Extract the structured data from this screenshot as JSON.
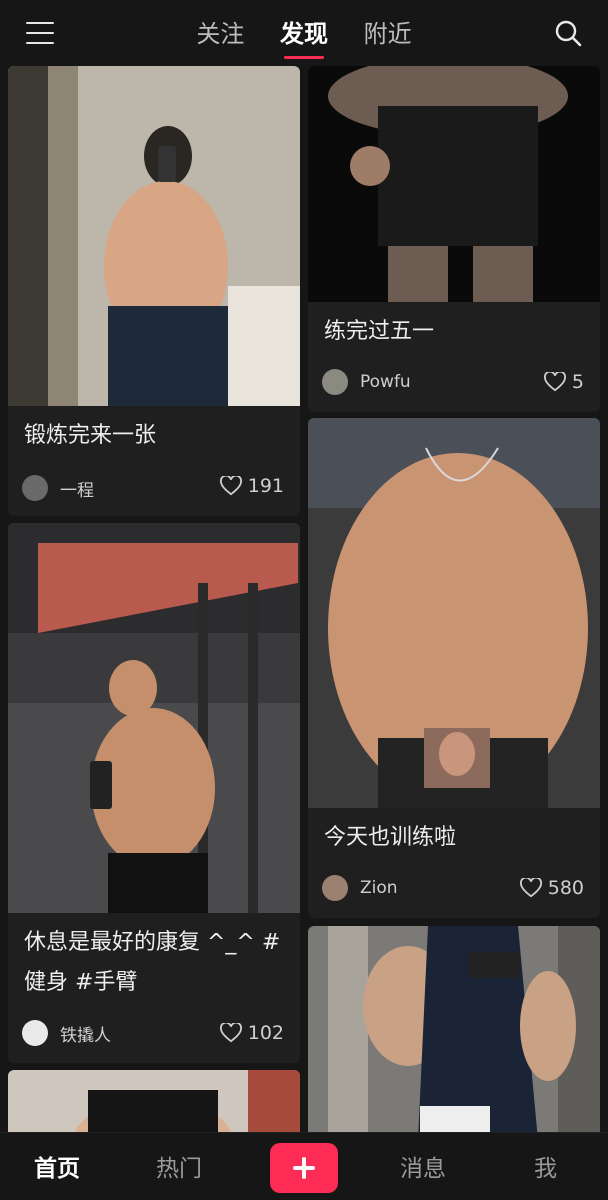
{
  "header": {
    "tabs": [
      {
        "label": "关注"
      },
      {
        "label": "发现"
      },
      {
        "label": "附近"
      }
    ],
    "active_tab": "发现"
  },
  "feed": {
    "left": [
      {
        "caption": "锻炼完来一张",
        "author": "一程",
        "likes": "191"
      },
      {
        "caption": "休息是最好的康复 ^_^ #健身 #手臂",
        "author": "铁撬人",
        "likes": "102"
      }
    ],
    "right": [
      {
        "caption": "练完过五一",
        "author": "Powfu",
        "likes": "5"
      },
      {
        "caption": "今天也训练啦",
        "author": "Zion",
        "likes": "580"
      }
    ]
  },
  "bottom_nav": {
    "home": "首页",
    "hot": "热门",
    "messages": "消息",
    "me": "我"
  },
  "colors": {
    "background": "#161616",
    "card": "#1f1f1f",
    "accent": "#fe2c55"
  },
  "icons": [
    "menu-icon",
    "search-icon",
    "heart-icon",
    "plus-icon"
  ]
}
